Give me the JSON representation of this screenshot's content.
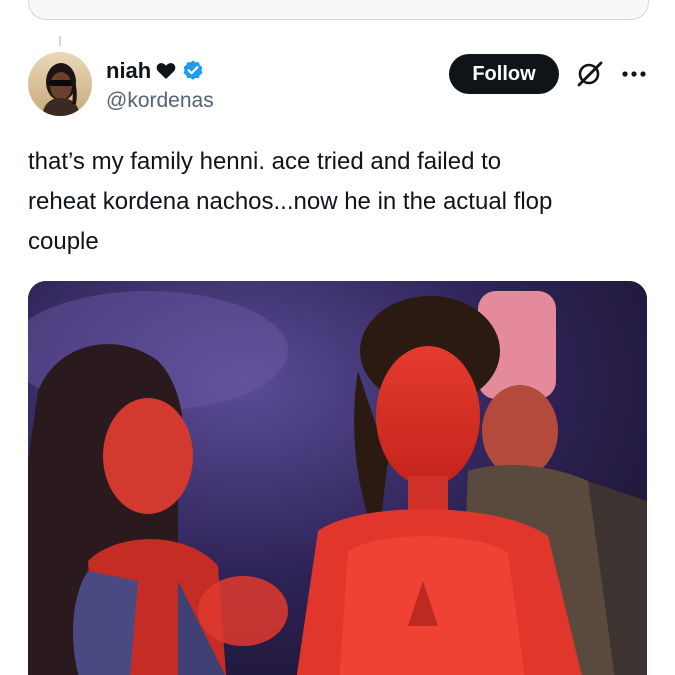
{
  "tweet": {
    "author": {
      "display_name": "niah",
      "handle": "@kordenas",
      "badge_icons": [
        "heart-icon",
        "verified-icon"
      ],
      "verified_color": "#1d9bf0"
    },
    "actions": {
      "follow_label": "Follow",
      "grok_icon": "grok-icon",
      "more_icon": "more-icon"
    },
    "text": "that’s my family henni. ace tried and failed to\nreheat kordena nachos...now he in the actual flop\ncouple"
  },
  "colors": {
    "text_primary": "#0f1419",
    "text_secondary": "#536471",
    "follow_bg": "#0f1419",
    "border": "#cfd9de"
  }
}
